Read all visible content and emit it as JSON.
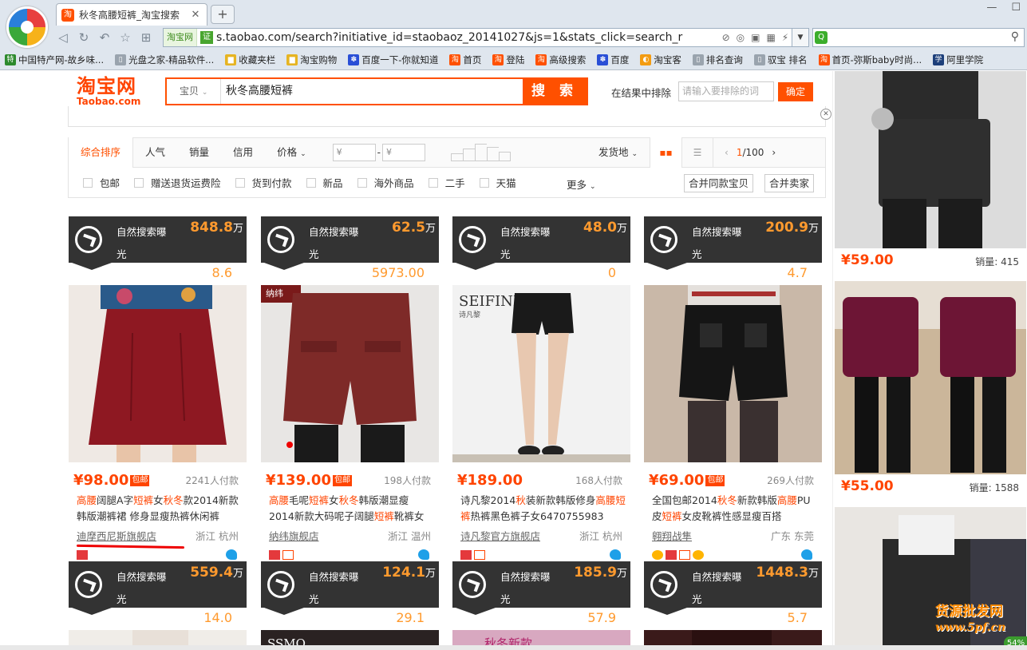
{
  "browser": {
    "tab_title": "秋冬高腰短裤_淘宝搜索",
    "tab_icon": "淘",
    "new_tab": "+",
    "url": "s.taobao.com/search?initiative_id=staobaoz_20141027&js=1&stats_click=search_r",
    "url_site_tag": "淘宝网",
    "url_secure_tag": "证",
    "search_engine_icon": "Q",
    "bookmarks": [
      {
        "label": "中国特产网-故乡味...",
        "icon": "特",
        "color": "#2d8a2d"
      },
      {
        "label": "光盘之家-精品软件...",
        "icon": "▯",
        "color": "#9aa4ae"
      },
      {
        "label": "收藏夹栏",
        "icon": "▆",
        "color": "#e6b422"
      },
      {
        "label": "淘宝购物",
        "icon": "▆",
        "color": "#e6b422"
      },
      {
        "label": "百度一下-你就知道",
        "icon": "✽",
        "color": "#2a4fd6"
      },
      {
        "label": "首页",
        "icon": "淘",
        "color": "#ff5000"
      },
      {
        "label": "登陆",
        "icon": "淘",
        "color": "#ff5000"
      },
      {
        "label": "高级搜索",
        "icon": "淘",
        "color": "#ff5000"
      },
      {
        "label": "百度",
        "icon": "✽",
        "color": "#2a4fd6"
      },
      {
        "label": "淘宝客",
        "icon": "◐",
        "color": "#f39c12"
      },
      {
        "label": "排名查询",
        "icon": "▯",
        "color": "#9aa4ae"
      },
      {
        "label": "驭宝 排名",
        "icon": "▯",
        "color": "#9aa4ae"
      },
      {
        "label": "首页-弥斯baby时尚...",
        "icon": "淘",
        "color": "#ff5000"
      },
      {
        "label": "阿里学院",
        "icon": "学",
        "color": "#1d3f7a"
      }
    ]
  },
  "header": {
    "logo_cn": "淘宝网",
    "logo_en": "Taobao.com",
    "search_category": "宝贝",
    "search_query": "秋冬高腰短裤",
    "search_button": "搜 索",
    "exclude_label": "在结果中排除",
    "exclude_placeholder": "请输入要排除的词",
    "exclude_button": "确定",
    "close": "✕"
  },
  "sortbar": {
    "tabs": [
      "综合排序",
      "人气",
      "销量",
      "信用"
    ],
    "price_label": "价格",
    "price_min": "¥",
    "price_max": "¥",
    "price_dash": "-",
    "ship_from": "发货地",
    "page_current": "1",
    "page_total": "/100"
  },
  "filters": {
    "options": [
      "包邮",
      "赠送退货运费险",
      "货到付款",
      "新品",
      "海外商品",
      "二手",
      "天猫"
    ],
    "more": "更多",
    "merge_same": "合并同款宝贝",
    "merge_seller": "合并卖家"
  },
  "cards": [
    {
      "banner_label": "自然搜索曝光",
      "banner_num": "848.8",
      "banner_unit": "万",
      "sub_num": "8.6",
      "price": "¥98.00",
      "free_ship": "包邮",
      "buyers": "2241人付款",
      "title_parts": [
        [
          "高腰",
          true
        ],
        [
          "阔腿A字",
          false
        ],
        [
          "短裤",
          true
        ],
        [
          "女",
          false
        ],
        [
          "秋冬",
          true
        ],
        [
          "款2014新款韩版潮裤裙 修身显瘦热裤休闲裤",
          false
        ]
      ],
      "shop": "迪摩西尼斯旗舰店",
      "location": "浙江 杭州"
    },
    {
      "banner_label": "自然搜索曝光",
      "banner_num": "62.5",
      "banner_unit": "万",
      "sub_num": "5973.00",
      "price": "¥139.00",
      "free_ship": "包邮",
      "buyers": "198人付款",
      "title_parts": [
        [
          "高腰",
          true
        ],
        [
          "毛呢",
          false
        ],
        [
          "短裤",
          true
        ],
        [
          "女",
          false
        ],
        [
          "秋冬",
          true
        ],
        [
          "韩版潮显瘦 2014新款大码呢子阔腿",
          false
        ],
        [
          "短裤",
          true
        ],
        [
          "靴裤女",
          false
        ]
      ],
      "shop": "纳纬旗舰店",
      "location": "浙江 温州"
    },
    {
      "banner_label": "自然搜索曝光",
      "banner_num": "48.0",
      "banner_unit": "万",
      "sub_num": "0",
      "price": "¥189.00",
      "free_ship": "",
      "buyers": "168人付款",
      "title_parts": [
        [
          "诗凡黎2014",
          false
        ],
        [
          "秋",
          true
        ],
        [
          "装新款韩版修身",
          false
        ],
        [
          "高腰",
          true
        ],
        [
          "短裤",
          true
        ],
        [
          "热裤黑色裤子女6470755983",
          false
        ]
      ],
      "shop": "诗凡黎官方旗舰店",
      "location": "浙江 杭州"
    },
    {
      "banner_label": "自然搜索曝光",
      "banner_num": "200.9",
      "banner_unit": "万",
      "sub_num": "4.7",
      "price": "¥69.00",
      "free_ship": "包邮",
      "buyers": "269人付款",
      "title_parts": [
        [
          "全国包邮2014",
          false
        ],
        [
          "秋冬",
          true
        ],
        [
          "新款韩版",
          false
        ],
        [
          "高腰",
          true
        ],
        [
          "PU皮",
          false
        ],
        [
          "短裤",
          true
        ],
        [
          "女皮靴裤性感显瘦百搭",
          false
        ]
      ],
      "shop": "翱翔战隼",
      "location": "广东 东莞"
    }
  ],
  "cards_row2": [
    {
      "banner_label": "自然搜索曝光",
      "banner_num": "559.4",
      "banner_unit": "万",
      "sub_num": "14.0"
    },
    {
      "banner_label": "自然搜索曝光",
      "banner_num": "124.1",
      "banner_unit": "万",
      "sub_num": "29.1"
    },
    {
      "banner_label": "自然搜索曝光",
      "banner_num": "185.9",
      "banner_unit": "万",
      "sub_num": "57.9"
    },
    {
      "banner_label": "自然搜索曝光",
      "banner_num": "1448.3",
      "banner_unit": "万",
      "sub_num": "5.7"
    }
  ],
  "sidebar": [
    {
      "price": "¥59.00",
      "sales": "销量: 415"
    },
    {
      "price": "¥55.00",
      "sales": "销量: 1588"
    }
  ],
  "watermark": {
    "line1": "货源批发网",
    "line2": "www.5pf.cn"
  },
  "float_badge": "54%",
  "colors": {
    "accent": "#ff5000",
    "banner": "#333333",
    "highlight": "#ff4400"
  }
}
